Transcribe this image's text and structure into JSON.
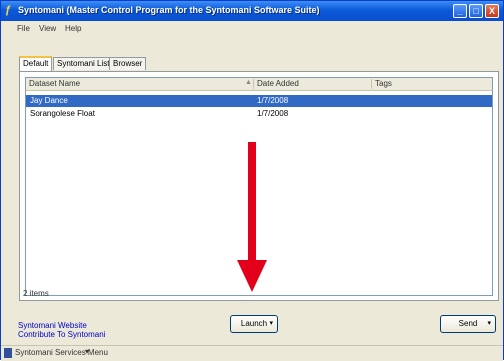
{
  "window": {
    "title": "Syntomani (Master Control Program for the Syntomani Software Suite)",
    "buttons": {
      "minimize": "_",
      "maximize": "□",
      "close": "X"
    }
  },
  "menu": [
    "File",
    "View",
    "Help"
  ],
  "tabs": [
    "Default",
    "Syntomani Lists",
    "Browser"
  ],
  "list": {
    "columns": [
      "Dataset Name",
      "Date Added",
      "Tags"
    ],
    "rows": [
      {
        "name": "Jay Dance",
        "date": "1/7/2008",
        "tags": ""
      },
      {
        "name": "Sorangolese Float",
        "date": "1/7/2008",
        "tags": ""
      }
    ]
  },
  "status": "2 items",
  "footer": {
    "link_line1": "Syntomani Website",
    "link_line2": "Contribute To Syntomani",
    "launch_label": "Launch",
    "send_label": "Send",
    "taskbar_label": "Syntomani Services Menu"
  },
  "colors": {
    "arrow": "#e3001b",
    "selection": "#316ac5",
    "titlebar": "#0a4ed0"
  }
}
